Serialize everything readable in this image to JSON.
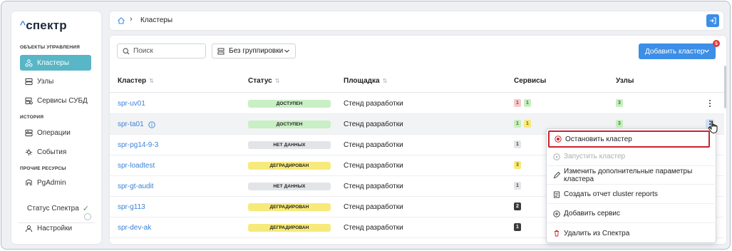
{
  "app": {
    "logo": "спектр",
    "logo_caret": "^"
  },
  "sidebar": {
    "sections": [
      {
        "title": "ОБЪЕКТЫ УПРАВЛЕНИЯ"
      },
      {
        "title": "ИСТОРИЯ"
      },
      {
        "title": "ПРОЧИЕ РЕСУРСЫ"
      }
    ],
    "items": [
      {
        "label": "Кластеры",
        "icon": "cluster-icon",
        "active": true
      },
      {
        "label": "Узлы",
        "icon": "server-icon"
      },
      {
        "label": "Сервисы СУБД",
        "icon": "database-icon"
      },
      {
        "label": "Операции",
        "icon": "operations-icon"
      },
      {
        "label": "События",
        "icon": "events-icon"
      },
      {
        "label": "PgAdmin",
        "icon": "pgadmin-icon"
      }
    ],
    "status_label": "Статус Спектра",
    "settings_label": "Настройки"
  },
  "breadcrumb": {
    "current": "Кластеры"
  },
  "toolbar": {
    "search_placeholder": "Поиск",
    "group_label": "Без группировки",
    "add_button_label": "Добавить кластер",
    "notification_count": "5"
  },
  "table": {
    "columns": [
      "Кластер",
      "Статус",
      "Площадка",
      "Сервисы",
      "Узлы"
    ],
    "rows": [
      {
        "name": "spr-uv01",
        "status": "ДОСТУПЕН",
        "site": "Стенд разработки",
        "services": [
          "1",
          "1"
        ],
        "nodes": [
          "3"
        ]
      },
      {
        "name": "spr-ta01",
        "status": "ДОСТУПЕН",
        "site": "Стенд разработки",
        "services": [
          "1",
          "1"
        ],
        "nodes": [
          "3"
        ]
      },
      {
        "name": "spr-pg14-9-3",
        "status": "НЕТ ДАННЫХ",
        "site": "Стенд разработки",
        "services": [
          "1"
        ],
        "nodes": []
      },
      {
        "name": "spr-loadtest",
        "status": "ДЕГРАДИРОВАН",
        "site": "Стенд разработки",
        "services": [
          "3"
        ],
        "nodes": []
      },
      {
        "name": "spr-gt-audit",
        "status": "НЕТ ДАННЫХ",
        "site": "Стенд разработки",
        "services": [
          "1"
        ],
        "nodes": []
      },
      {
        "name": "spr-g113",
        "status": "ДЕГРАДИРОВАН",
        "site": "Стенд разработки",
        "services": [
          "2"
        ],
        "nodes": []
      },
      {
        "name": "spr-dev-ak",
        "status": "ДЕГРАДИРОВАН",
        "site": "Стенд разработки",
        "services": [
          "1"
        ],
        "nodes": []
      }
    ]
  },
  "context_menu": {
    "items": [
      {
        "label": "Остановить кластер",
        "icon": "stop-icon"
      },
      {
        "label": "Запустить кластер",
        "icon": "play-icon",
        "disabled": true
      },
      {
        "label": "Изменить дополнительные параметры кластера",
        "icon": "pencil-icon"
      },
      {
        "label": "Создать отчет cluster reports",
        "icon": "report-icon"
      },
      {
        "label": "Добавить сервис",
        "icon": "plus-circle-icon"
      },
      {
        "label": "Удалить из Спектра",
        "icon": "trash-icon"
      }
    ]
  },
  "colors": {
    "accent": "#3c8ee6",
    "sidebar_active": "#58b6c6",
    "status_ok": "#c9efc4",
    "status_nodata": "#e2e4e8",
    "status_degraded": "#f7ea7a",
    "chip_red": "#f6c9c9",
    "chip_green": "#c8eec1",
    "chip_yellow": "#f7ea7a",
    "chip_gray": "#e3e5e8",
    "chip_dark": "#3b3b3b",
    "highlight_border": "#c8252d"
  }
}
